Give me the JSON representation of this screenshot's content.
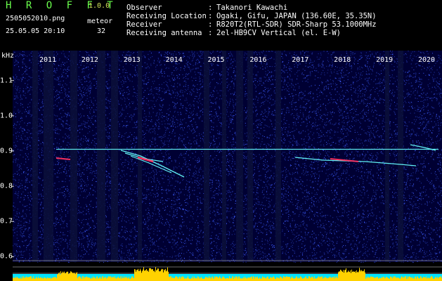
{
  "header": {
    "app_title": "H R O F F T",
    "app_version": "1.0.0",
    "filename": "2505052010.png",
    "mode": "meteor",
    "datetime": "25.05.05 20:10",
    "count": "32"
  },
  "info": [
    {
      "label": "Observer",
      "value": "Takanori Kawachi"
    },
    {
      "label": "Receiving Location",
      "value": "Ogaki, Gifu, JAPAN (136.60E, 35.35N)"
    },
    {
      "label": "Receiver",
      "value": "R820T2(RTL-SDR) SDR-Sharp 53.1000MHz"
    },
    {
      "label": "Receiving antenna",
      "value": "2el-HB9CV Vertical (el. E-W)"
    }
  ],
  "separator": ":",
  "chart_data": {
    "type": "heatmap",
    "ylabel": "kHz",
    "y_ticks": [
      "1.1",
      "1.0",
      "0.9",
      "0.8",
      "0.7",
      "0.6"
    ],
    "y_tick_values": [
      1.1,
      1.0,
      0.9,
      0.8,
      0.7,
      0.6
    ],
    "ylim": [
      0.585,
      1.185
    ],
    "x_labels": [
      "2011",
      "2012",
      "2013",
      "2014",
      "2015",
      "2016",
      "2017",
      "2018",
      "2019",
      "2020"
    ],
    "carrier_khz": 0.905,
    "colors": {
      "background": "#000033",
      "noise_low": "#1a2a8c",
      "noise_high": "#3f5dff",
      "carrier": "#66ffff",
      "echo": "#ff3060",
      "band": "#0b0f3a",
      "baseline": "#00e5ff",
      "activity": "#ffd200",
      "grid": "#cfcfcf"
    }
  }
}
